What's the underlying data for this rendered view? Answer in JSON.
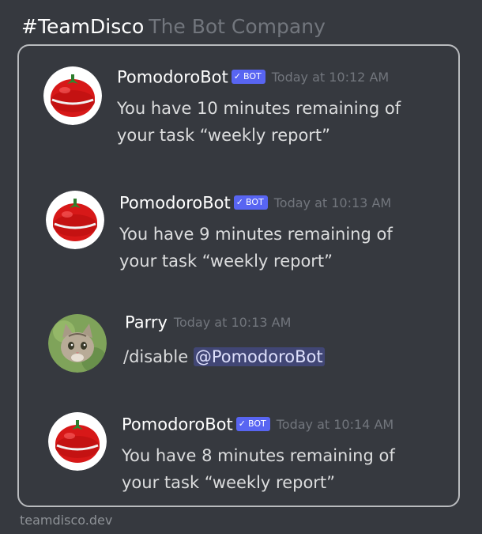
{
  "header": {
    "channel": "#TeamDisco",
    "company": "The Bot Company"
  },
  "messages": [
    {
      "author": "PomodoroBot",
      "badge": "BOT",
      "timestamp": "Today at 10:12 AM",
      "text_line1": "You have 10 minutes remaining of",
      "text_line2": "your task “weekly report”"
    },
    {
      "author": "PomodoroBot",
      "badge": "BOT",
      "timestamp": "Today at 10:13 AM",
      "text_line1": "You have 9 minutes remaining of",
      "text_line2": "your task “weekly report”"
    },
    {
      "author": "Parry",
      "timestamp": "Today at 10:13 AM",
      "command": "/disable",
      "mention": "@PomodoroBot"
    },
    {
      "author": "PomodoroBot",
      "badge": "BOT",
      "timestamp": "Today at 10:14 AM",
      "text_line1": "You have 8 minutes remaining of",
      "text_line2": "your task “weekly report”"
    }
  ],
  "footer": {
    "site": "teamdisco.dev"
  },
  "colors": {
    "background": "#36393f",
    "bot_badge": "#5865f2",
    "mention_bg": "#414675",
    "timestamp": "#72767d"
  },
  "icons": {
    "bot_avatar": "tomato-timer-avatar",
    "user_avatar": "cat-avatar",
    "badge_check": "check-icon"
  }
}
